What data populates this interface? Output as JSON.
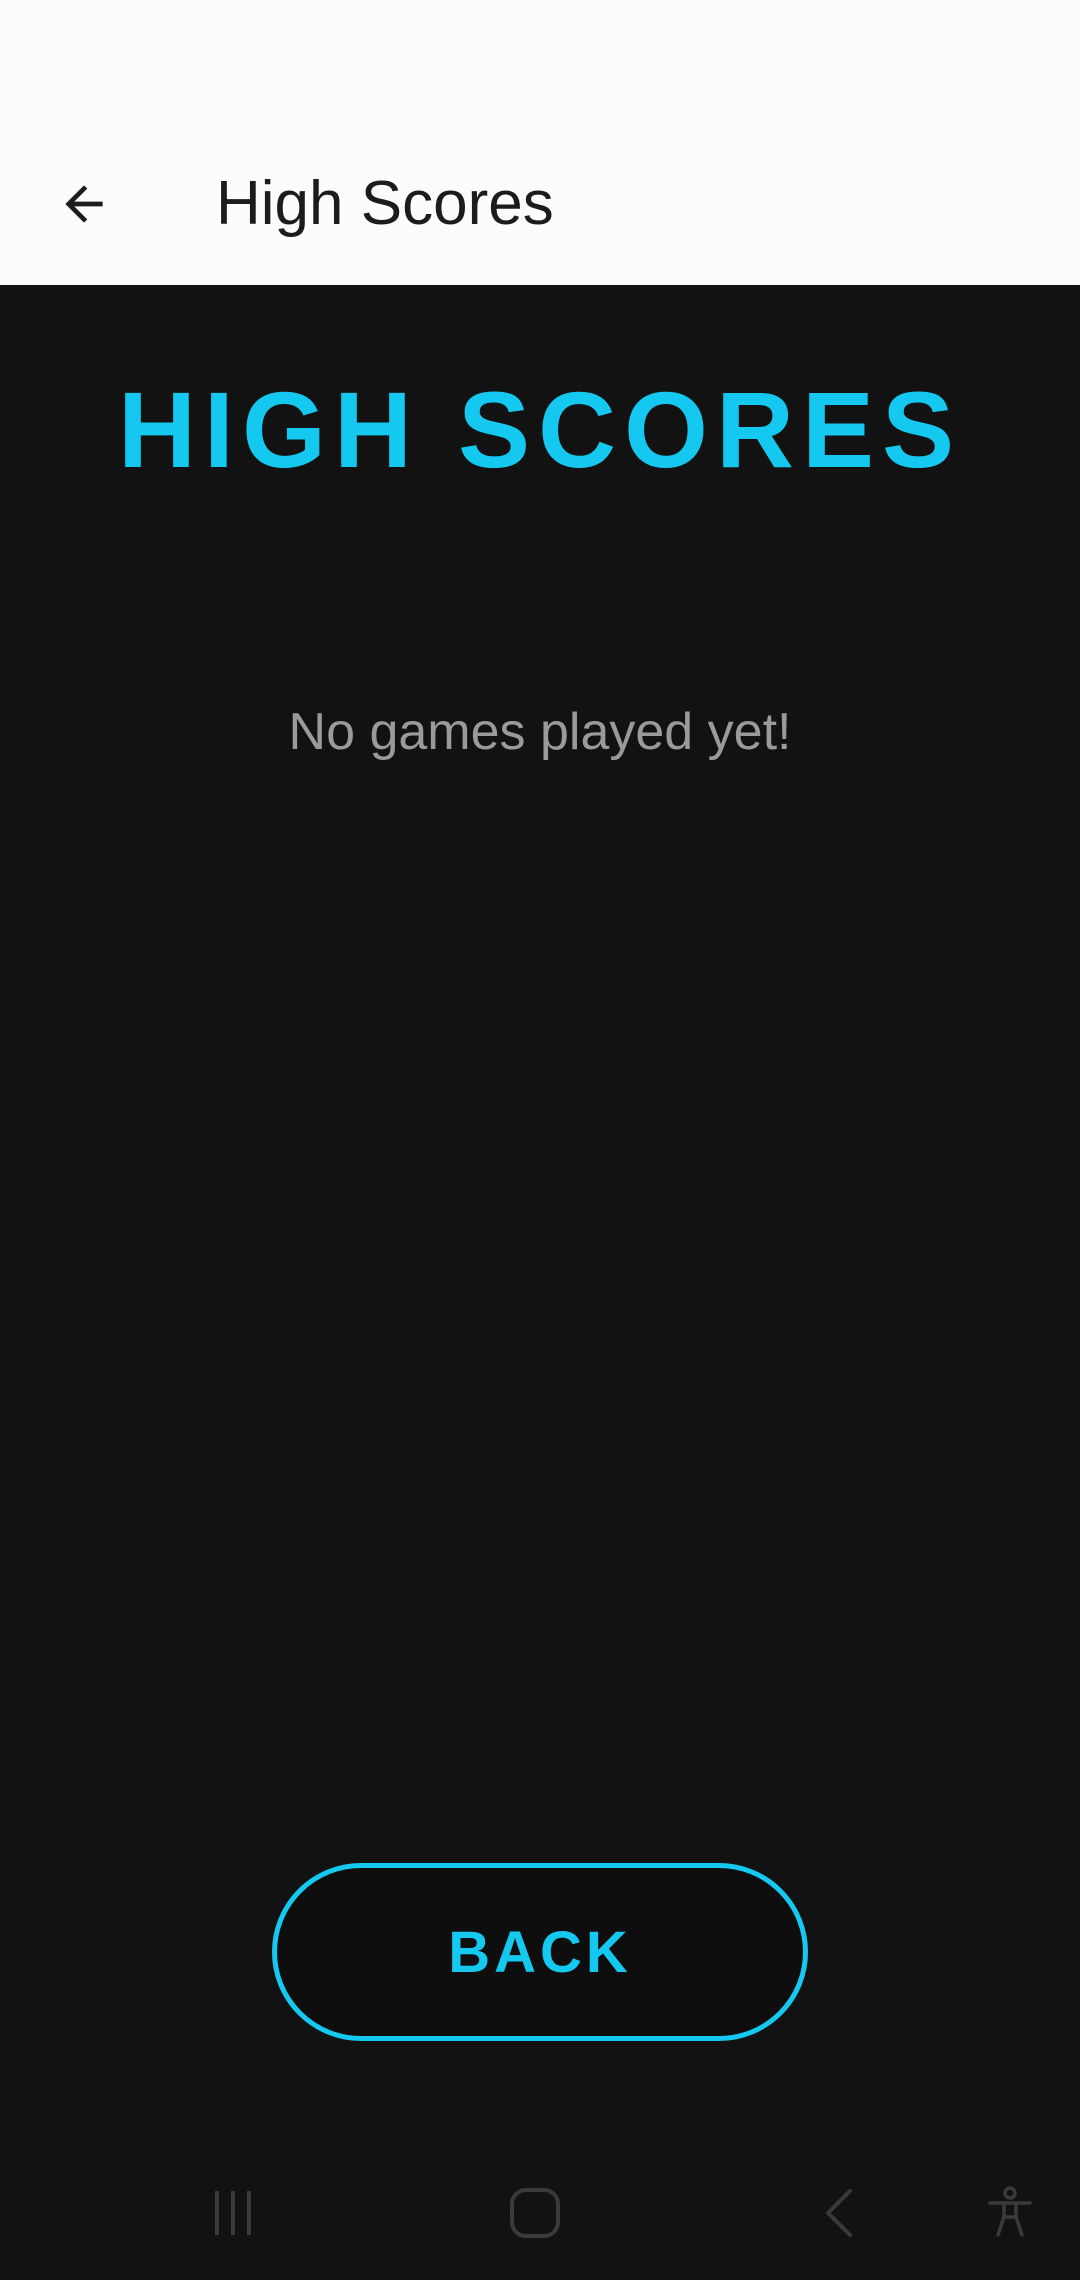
{
  "app_bar": {
    "title": "High Scores",
    "back_icon": "arrow-left-icon"
  },
  "main": {
    "heading": "HIGH SCORES",
    "empty_message": "No games played yet!",
    "back_button_label": "BACK"
  },
  "nav": {
    "recents_icon": "recents-icon",
    "home_icon": "home-icon",
    "back_icon": "nav-back-icon",
    "accessibility_icon": "accessibility-icon"
  },
  "colors": {
    "accent": "#14c8f0",
    "background": "#121212",
    "app_bar": "#fcfcfc",
    "muted_text": "#9a9a9a"
  }
}
